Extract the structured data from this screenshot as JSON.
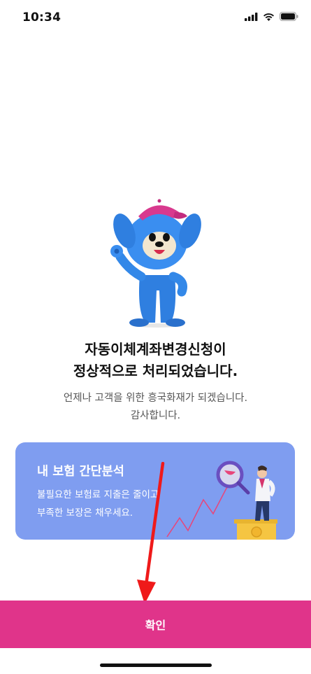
{
  "status_bar": {
    "time": "10:34"
  },
  "message": {
    "title_line1": "자동이체계좌변경신청이",
    "title_line2": "정상적으로 처리되었습니다.",
    "subtitle_line1": "언제나 고객을 위한 흥국화재가 되겠습니다.",
    "subtitle_line2": "감사합니다."
  },
  "banner": {
    "title": "내 보험 간단분석",
    "desc_line1": "불필요한 보험료 지출은 줄이고",
    "desc_line2": "부족한 보장은 채우세요.",
    "background_color": "#7f9df0"
  },
  "footer": {
    "confirm_label": "확인",
    "button_color": "#e0348a"
  },
  "icons": [
    "signal-icon",
    "wifi-icon",
    "battery-icon",
    "mascot-image",
    "analysis-illustration",
    "annotation-arrow"
  ]
}
